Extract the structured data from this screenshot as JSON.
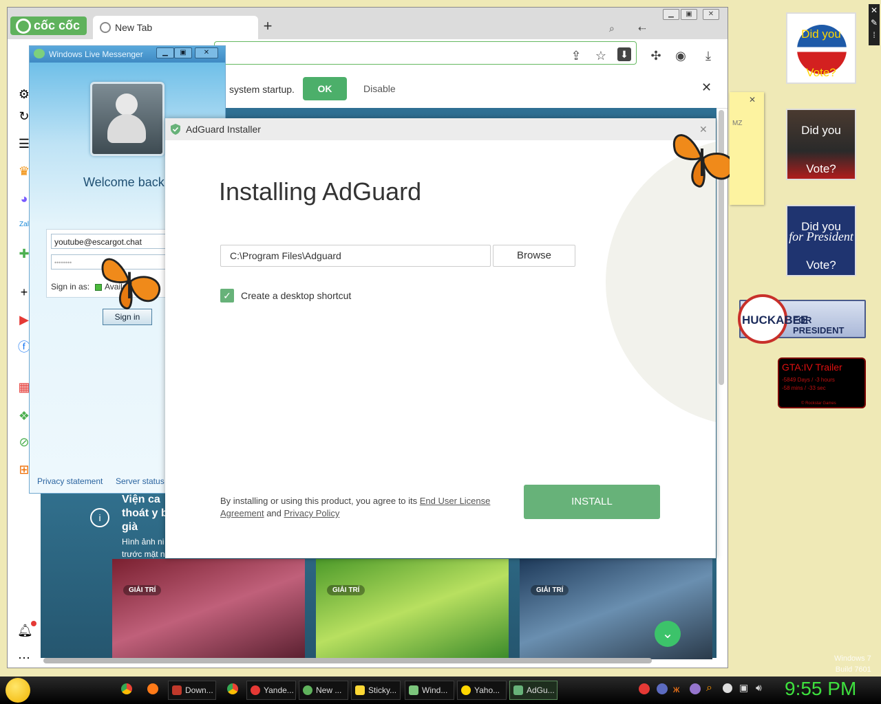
{
  "browser": {
    "logo_text": "cốc cốc",
    "tab_title": "New Tab",
    "new_tab_symbol": "+",
    "infobar": {
      "text": "system startup.",
      "ok_label": "OK",
      "disable_label": "Disable",
      "close_symbol": "✕"
    },
    "cards": [
      {
        "tag": "GIẢI TRÍ"
      },
      {
        "tag": "GIẢI TRÍ"
      },
      {
        "tag": "GIẢI TRÍ"
      }
    ],
    "news_snippet": {
      "line1": "Viện ca",
      "line2": "thoát y b",
      "line3": "già",
      "line4": "Hình ảnh ni",
      "line5": "trước mặt n"
    }
  },
  "messenger": {
    "title": "Windows Live Messenger",
    "welcome": "Welcome back",
    "email": "youtube@escargot.chat",
    "password_mask": "••••••••",
    "sign_in_as_label": "Sign in as:",
    "status": "Availa",
    "sign_in_button": "Sign in",
    "privacy_link": "Privacy statement",
    "server_link": "Server status"
  },
  "adguard": {
    "window_title": "AdGuard Installer",
    "heading": "Installing AdGuard",
    "install_path": "C:\\Program Files\\Adguard",
    "browse_label": "Browse",
    "shortcut_label": "Create a desktop shortcut",
    "shortcut_checked": true,
    "agreement_prefix": "By installing or using this product, you agree to its ",
    "eula_link": "End User License Agreement",
    "agreement_and": " and ",
    "privacy_link": "Privacy Policy",
    "install_label": "INSTALL",
    "accent_color": "#67b279"
  },
  "gadgets": {
    "vote1_top": "Did you",
    "vote1_bottom": "Vote?",
    "vote2_top": "Did you",
    "vote2_bottom": "Vote?",
    "vote3_top": "Did you",
    "vote3_mid": "for President",
    "vote3_bottom": "Vote?",
    "huckabee_name": "HUCKABEE",
    "huckabee_for": "FOR PRESIDENT",
    "gta_title": "GTA:IV Trailer",
    "gta_line1": "-5849 Days / -3 hours",
    "gta_line2": "-58 mins / -33 sec",
    "gta_footer": "© Rockstar Games",
    "sticky_text": "MZ"
  },
  "watermark": {
    "line1": "Windows 7",
    "line2": "Build 7601"
  },
  "taskbar": {
    "items": [
      "Down...",
      "Yande...",
      "New ...",
      "Sticky...",
      "Wind...",
      "Yaho...",
      "AdGu..."
    ],
    "clock": "9:55 PM"
  }
}
